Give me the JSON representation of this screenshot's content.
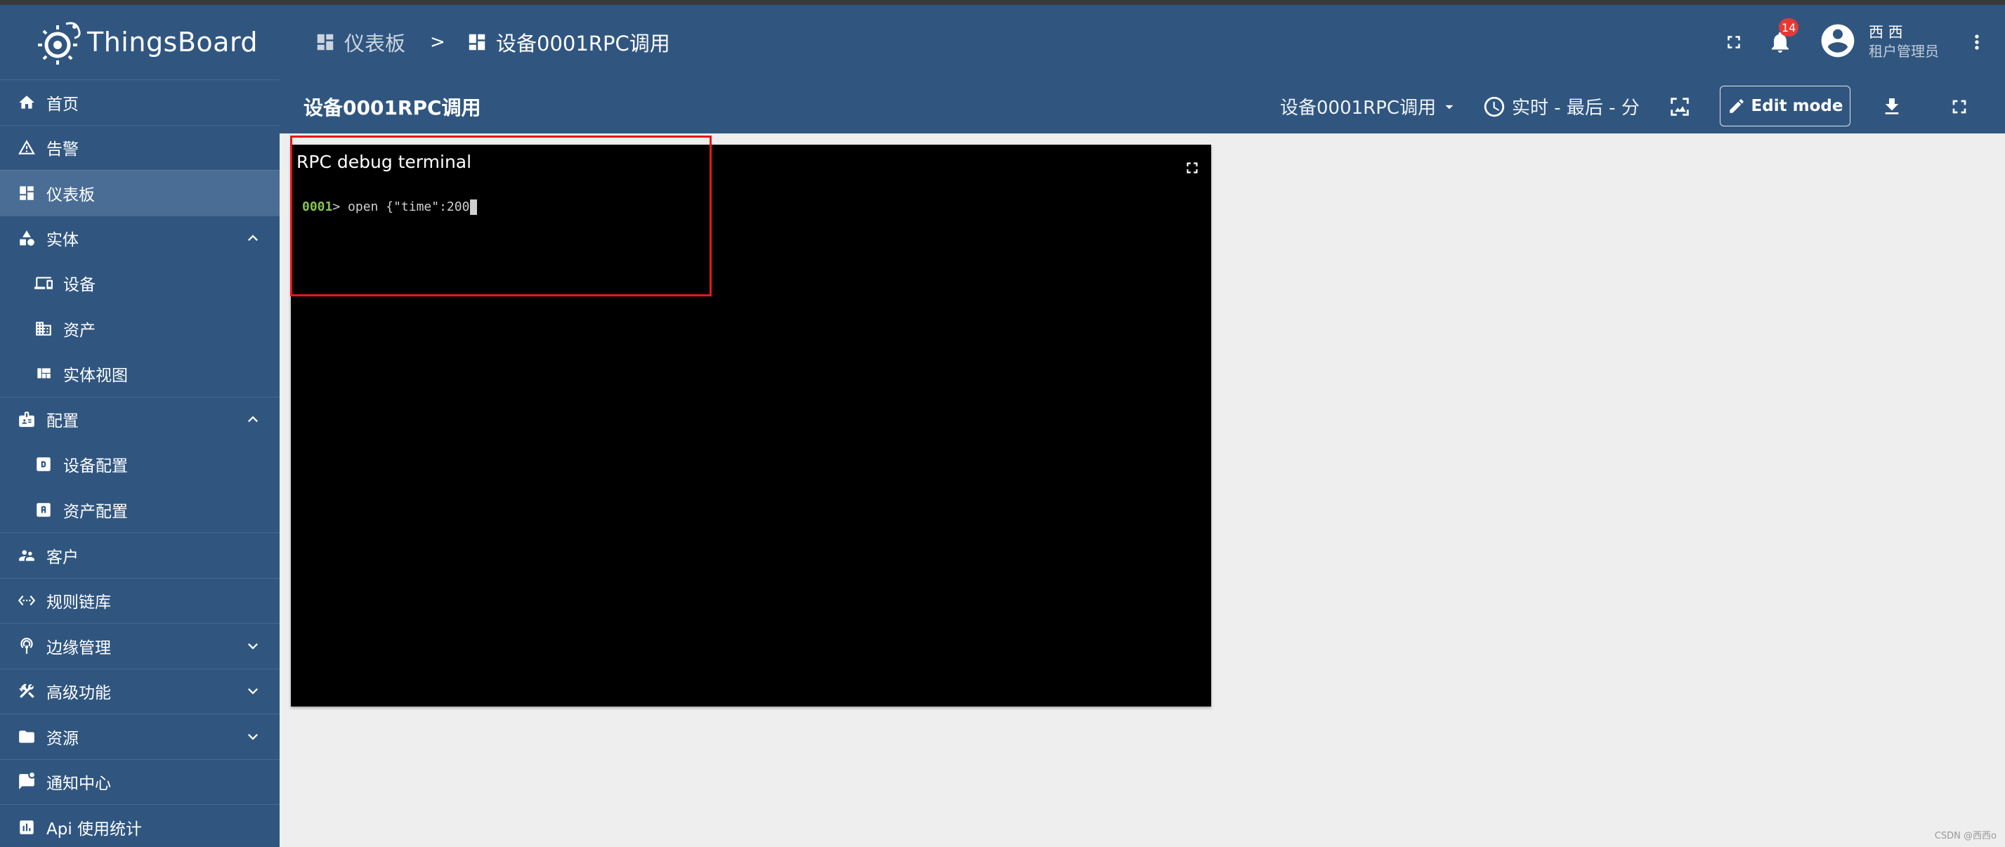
{
  "app": {
    "logo_text": "ThingsBoard"
  },
  "sidebar": {
    "items": [
      {
        "label": "首页",
        "icon": "home-icon"
      },
      {
        "label": "告警",
        "icon": "warning-icon"
      },
      {
        "label": "仪表板",
        "icon": "dashboard-icon",
        "active": true
      },
      {
        "label": "实体",
        "icon": "category-icon",
        "expanded": true
      },
      {
        "label": "设备",
        "icon": "devices-icon"
      },
      {
        "label": "资产",
        "icon": "domain-icon"
      },
      {
        "label": "实体视图",
        "icon": "view-quilt-icon"
      },
      {
        "label": "配置",
        "icon": "badge-icon",
        "expanded": true
      },
      {
        "label": "设备配置",
        "icon": "device-profile-icon"
      },
      {
        "label": "资产配置",
        "icon": "asset-profile-icon"
      },
      {
        "label": "客户",
        "icon": "supervisor-account-icon"
      },
      {
        "label": "规则链库",
        "icon": "settings-ethernet-icon"
      },
      {
        "label": "边缘管理",
        "icon": "router-icon",
        "expanded": false
      },
      {
        "label": "高级功能",
        "icon": "construction-icon",
        "expanded": false
      },
      {
        "label": "资源",
        "icon": "folder-icon",
        "expanded": false
      },
      {
        "label": "通知中心",
        "icon": "mark-chat-unread-icon"
      },
      {
        "label": "Api 使用统计",
        "icon": "insert-chart-icon"
      }
    ]
  },
  "header": {
    "breadcrumb": [
      {
        "label": "仪表板"
      },
      {
        "label": "设备0001RPC调用"
      }
    ],
    "breadcrumb_separator": ">",
    "notifications_count": "14",
    "user": {
      "name": "西 西",
      "role": "租户管理员"
    }
  },
  "dashboard": {
    "title": "设备0001RPC调用",
    "state_select": "设备0001RPC调用",
    "timewindow": "实时 - 最后 - 分",
    "edit_mode_label": "Edit mode"
  },
  "widget": {
    "title": "RPC debug terminal",
    "terminal_prefix": "0001",
    "terminal_prompt": "> ",
    "terminal_input": "open {\"time\":200"
  },
  "colors": {
    "primary": "#305680",
    "sidebar_active": "#4a6d96",
    "badge": "#e53935",
    "highlight": "#e8161b",
    "terminal_prefix": "#8bc34a"
  },
  "watermark": "CSDN @西西o"
}
